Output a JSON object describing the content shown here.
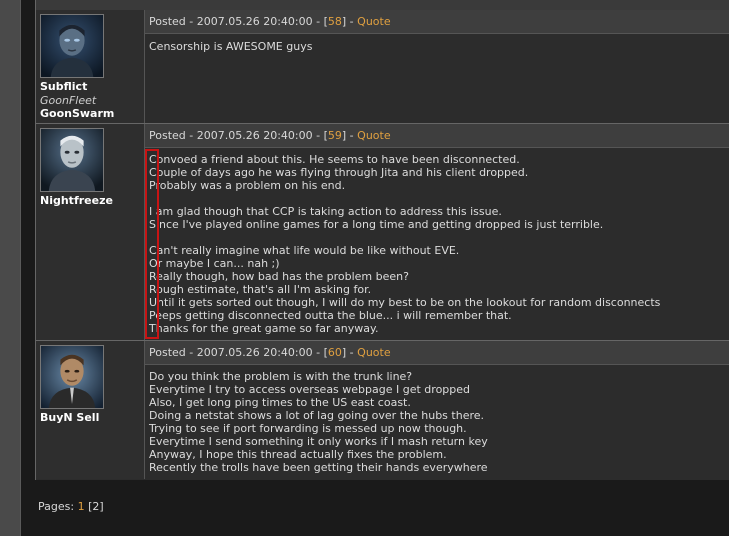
{
  "posts": [
    {
      "author": {
        "name": "Subflict",
        "corp": "GoonFleet",
        "alliance": "GoonSwarm"
      },
      "posted_label": "Posted - ",
      "timestamp": "2007.05.26 20:40:00",
      "post_number": "58",
      "quote_label": "Quote",
      "body": [
        "Censorship is AWESOME guys"
      ]
    },
    {
      "author": {
        "name": "Nightfreeze"
      },
      "posted_label": "Posted - ",
      "timestamp": "2007.05.26 20:40:00",
      "post_number": "59",
      "quote_label": "Quote",
      "body": [
        "Convoed a friend about this. He seems to have been disconnected.",
        "Couple of days ago he was flying through Jita and his client dropped.",
        "Probably was a problem on his end.",
        "",
        "I am glad though that CCP is taking action to address this issue.",
        "Since I've played online games for a long time and getting dropped is just terrible.",
        "",
        "Can't really imagine what life would be like without EVE.",
        "Or maybe I can... nah ;)",
        "Really though, how bad has the problem been?",
        "Rough estimate, that's all I'm asking for.",
        "Until it gets sorted out though, I will do my best to be on the lookout for random disconnects",
        "Peeps getting disconnected outta the blue... i will remember that.",
        "Thanks for the great game so far anyway."
      ]
    },
    {
      "author": {
        "name": "BuyN Sell"
      },
      "posted_label": "Posted - ",
      "timestamp": "2007.05.26 20:40:00",
      "post_number": "60",
      "quote_label": "Quote",
      "body": [
        "Do you think the problem is with the trunk line?",
        "Everytime I try to access overseas webpage I get dropped",
        "Also, I get long ping times to the US east coast.",
        "Doing a netstat shows a lot of lag going over the hubs there.",
        "Trying to see if port forwarding is messed up now though.",
        "Everytime I send something it only works if I mash return key",
        "Anyway, I hope this thread actually fixes the problem.",
        "Recently the trolls have been getting their hands everywhere"
      ]
    }
  ],
  "pagination": {
    "label": "Pages: ",
    "current": "1",
    "other": "[2]"
  },
  "colors": {
    "link": "#e0a040",
    "highlight_box": "#c81414"
  }
}
